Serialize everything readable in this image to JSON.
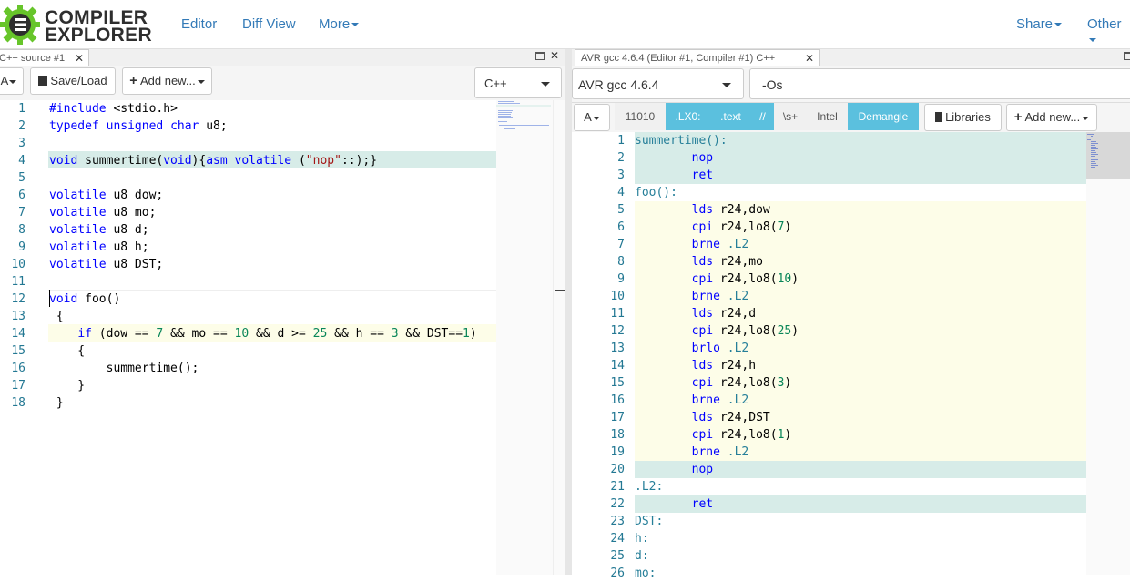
{
  "nav": {
    "logo_line1": "COMPILER",
    "logo_line2": "EXPLORER",
    "editor": "Editor",
    "diff_view": "Diff View",
    "more": "More",
    "share": "Share",
    "other": "Other",
    "accent": "#337ab7",
    "logo_green": "#67c52a"
  },
  "left": {
    "tab_title": "C++ source #1",
    "font_btn": "A",
    "save_load": "Save/Load",
    "add_new": "Add new...",
    "language": "C++",
    "code_lines": [
      "#include <stdio.h>",
      "typedef unsigned char u8;",
      "",
      "void summertime(void){asm volatile (\"nop\"::);}",
      "",
      "volatile u8 dow;",
      "volatile u8 mo;",
      "volatile u8 d;",
      "volatile u8 h;",
      "volatile u8 DST;",
      "",
      "void foo()",
      " {",
      "    if (dow == 7 && mo == 10 && d >= 25 && h == 3 && DST==1)",
      "    {",
      "        summertime();",
      "    }",
      " }"
    ]
  },
  "right": {
    "tab_title": "AVR gcc 4.6.4 (Editor #1, Compiler #1) C++",
    "compiler": "AVR gcc 4.6.4",
    "options": "-Os",
    "font_btn": "A",
    "filters": [
      "11010",
      ".LX0:",
      ".text",
      "//",
      "\\s+",
      "Intel",
      "Demangle"
    ],
    "libraries": "Libraries",
    "add_new": "Add new...",
    "asm_lines": [
      "summertime():",
      "        nop",
      "        ret",
      "foo():",
      "        lds r24,dow",
      "        cpi r24,lo8(7)",
      "        brne .L2",
      "        lds r24,mo",
      "        cpi r24,lo8(10)",
      "        brne .L2",
      "        lds r24,d",
      "        cpi r24,lo8(25)",
      "        brlo .L2",
      "        lds r24,h",
      "        cpi r24,lo8(3)",
      "        brne .L2",
      "        lds r24,DST",
      "        cpi r24,lo8(1)",
      "        brne .L2",
      "        nop",
      ".L2:",
      "        ret",
      "DST:",
      "h:",
      "d:",
      "mo:"
    ]
  }
}
